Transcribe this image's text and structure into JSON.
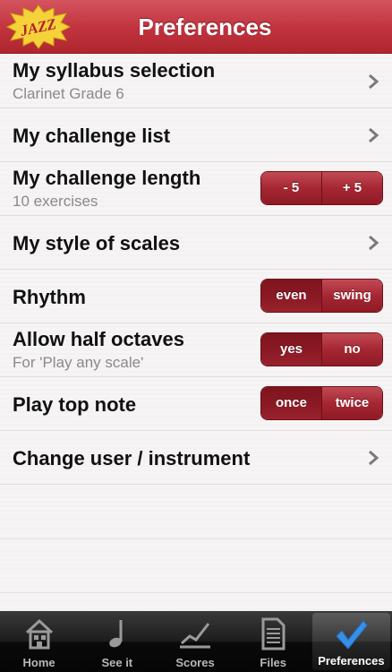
{
  "header": {
    "title": "Preferences",
    "logo_text": "JAZZ"
  },
  "rows": {
    "syllabus": {
      "label": "My syllabus selection",
      "sub": "Clarinet Grade 6"
    },
    "challenge_list": {
      "label": "My challenge list"
    },
    "challenge_length": {
      "label": "My challenge length",
      "sub": "10 exercises",
      "options": [
        "- 5",
        "+ 5"
      ]
    },
    "scales_style": {
      "label": "My style of scales"
    },
    "rhythm": {
      "label": "Rhythm",
      "options": [
        "even",
        "swing"
      ]
    },
    "half_octaves": {
      "label": "Allow half octaves",
      "sub": "For 'Play any scale'",
      "options": [
        "yes",
        "no"
      ]
    },
    "top_note": {
      "label": "Play top note",
      "options": [
        "once",
        "twice"
      ]
    },
    "change_user": {
      "label": "Change user / instrument"
    }
  },
  "tabbar": {
    "items": [
      {
        "label": "Home",
        "icon": "house-icon"
      },
      {
        "label": "See it",
        "icon": "music-note-icon"
      },
      {
        "label": "Scores",
        "icon": "chart-trend-icon"
      },
      {
        "label": "Files",
        "icon": "document-icon"
      },
      {
        "label": "Preferences",
        "icon": "checkmark-icon"
      }
    ],
    "active_index": 4
  },
  "colors": {
    "header": "#c23440",
    "segment": "#a52733",
    "tabbar": "#111111",
    "accent_check": "#3a8ee6"
  }
}
